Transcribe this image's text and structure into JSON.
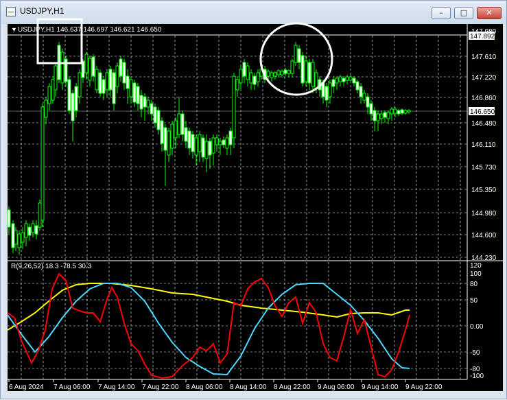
{
  "window": {
    "title": "USDJPY,H1",
    "buttons": {
      "minimize": "–",
      "maximize": "□",
      "close": "✕"
    }
  },
  "price_panel": {
    "header": "USDJPY,H1  146.637 146.697 146.621 146.650",
    "price_ticks": [
      "147.980",
      "147.610",
      "147.220",
      "146.860",
      "146.480",
      "146.110",
      "145.730",
      "145.350",
      "144.980",
      "144.600",
      "144.230"
    ],
    "current_price_label": "146.650",
    "upper_label": "147.892"
  },
  "indicator_panel": {
    "header": "R(9,26,52) 18.3 -78.5 30.3",
    "ticks": [
      "120",
      "100",
      "80",
      "50",
      "0.00",
      "-50",
      "-80",
      "-100"
    ]
  },
  "time_axis": [
    "6 Aug 2024",
    "7 Aug 06:00",
    "7 Aug 14:00",
    "7 Aug 22:00",
    "8 Aug 06:00",
    "8 Aug 14:00",
    "8 Aug 22:00",
    "9 Aug 06:00",
    "9 Aug 14:00",
    "9 Aug 22:00"
  ],
  "colors": {
    "background": "#000000",
    "grid": "#ffffff",
    "bull": "#00ff00",
    "bear": "#00ff00",
    "bull_fill": "#000000",
    "bear_fill": "#ffffff",
    "line_red": "#ff0000",
    "line_cyan": "#4dd9ff",
    "line_yellow": "#ffff00"
  }
}
